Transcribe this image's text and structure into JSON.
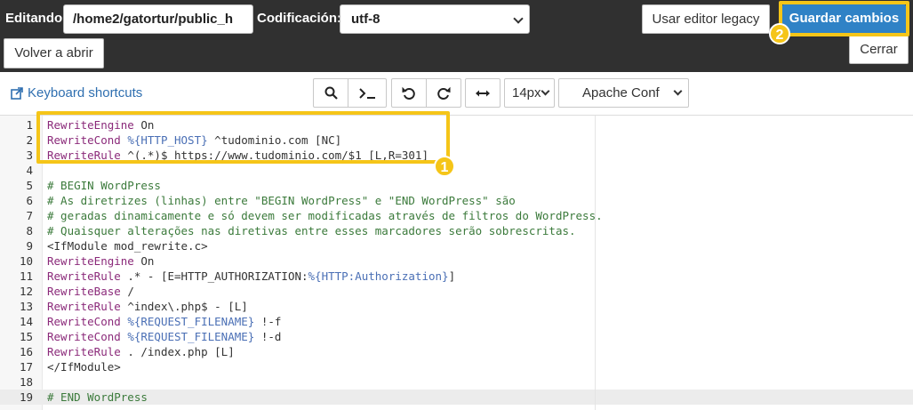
{
  "header": {
    "editing_label": "Editando:",
    "path_value": "/home2/gatortur/public_h",
    "encoding_label": "Codificación:",
    "encoding_value": "utf-8",
    "legacy_button": "Usar editor legacy",
    "save_button": "Guardar cambios",
    "reopen_button": "Volver a abrir",
    "close_button": "Cerrar",
    "badge_save": "2"
  },
  "toolbar": {
    "keyboard_shortcuts": "Keyboard shortcuts",
    "font_size": "14px",
    "mode": "Apache Conf",
    "icons": [
      "search-icon",
      "terminal-icon",
      "undo-icon",
      "redo-icon",
      "wrap-icon"
    ]
  },
  "highlight": {
    "badge": "1",
    "color": "#f5c518"
  },
  "editor": {
    "active_line": 19,
    "lines": [
      {
        "n": "1",
        "parts": [
          [
            "kw",
            "RewriteEngine"
          ],
          [
            "t",
            " On"
          ]
        ]
      },
      {
        "n": "2",
        "parts": [
          [
            "kw",
            "RewriteCond"
          ],
          [
            "t",
            " "
          ],
          [
            "vr",
            "%{HTTP_HOST}"
          ],
          [
            "t",
            " ^tudominio.com [NC]"
          ]
        ]
      },
      {
        "n": "3",
        "parts": [
          [
            "kw",
            "RewriteRule"
          ],
          [
            "t",
            " ^(.*)$ https://www.tudominio.com/$1 [L,R=301]"
          ]
        ]
      },
      {
        "n": "4",
        "parts": []
      },
      {
        "n": "5",
        "parts": [
          [
            "cm",
            "# BEGIN WordPress"
          ]
        ]
      },
      {
        "n": "6",
        "parts": [
          [
            "cm",
            "# As diretrizes (linhas) entre \"BEGIN WordPress\" e \"END WordPress\" são"
          ]
        ]
      },
      {
        "n": "7",
        "parts": [
          [
            "cm",
            "# geradas dinamicamente e só devem ser modificadas através de filtros do WordPress."
          ]
        ]
      },
      {
        "n": "8",
        "parts": [
          [
            "cm",
            "# Quaisquer alterações nas diretivas entre esses marcadores serão sobrescritas."
          ]
        ]
      },
      {
        "n": "9",
        "parts": [
          [
            "t",
            "<IfModule mod_rewrite.c>"
          ]
        ]
      },
      {
        "n": "10",
        "parts": [
          [
            "kw",
            "RewriteEngine"
          ],
          [
            "t",
            " On"
          ]
        ]
      },
      {
        "n": "11",
        "parts": [
          [
            "kw",
            "RewriteRule"
          ],
          [
            "t",
            " .* - [E=HTTP_AUTHORIZATION:"
          ],
          [
            "vr",
            "%{HTTP:Authorization}"
          ],
          [
            "t",
            "]"
          ]
        ]
      },
      {
        "n": "12",
        "parts": [
          [
            "kw",
            "RewriteBase"
          ],
          [
            "t",
            " /"
          ]
        ]
      },
      {
        "n": "13",
        "parts": [
          [
            "kw",
            "RewriteRule"
          ],
          [
            "t",
            " ^index\\.php$ - [L]"
          ]
        ]
      },
      {
        "n": "14",
        "parts": [
          [
            "kw",
            "RewriteCond"
          ],
          [
            "t",
            " "
          ],
          [
            "vr",
            "%{REQUEST_FILENAME}"
          ],
          [
            "t",
            " !-f"
          ]
        ]
      },
      {
        "n": "15",
        "parts": [
          [
            "kw",
            "RewriteCond"
          ],
          [
            "t",
            " "
          ],
          [
            "vr",
            "%{REQUEST_FILENAME}"
          ],
          [
            "t",
            " !-d"
          ]
        ]
      },
      {
        "n": "16",
        "parts": [
          [
            "kw",
            "RewriteRule"
          ],
          [
            "t",
            " . /index.php [L]"
          ]
        ]
      },
      {
        "n": "17",
        "parts": [
          [
            "t",
            "</IfModule>"
          ]
        ]
      },
      {
        "n": "18",
        "parts": []
      },
      {
        "n": "19",
        "parts": [
          [
            "cm",
            "# END WordPress"
          ]
        ]
      }
    ]
  }
}
